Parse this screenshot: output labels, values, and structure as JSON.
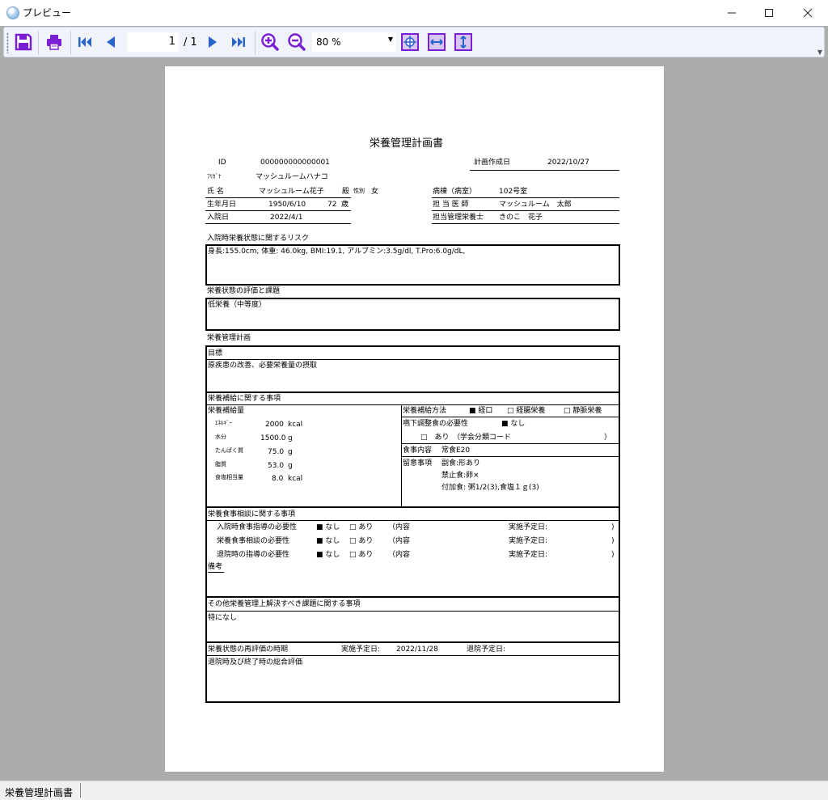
{
  "window": {
    "title": "プレビュー",
    "minimize": "—",
    "maximize": "☐",
    "close": "✕"
  },
  "toolbar": {
    "page_current": "1",
    "page_total": "/ 1",
    "zoom": "80 %"
  },
  "doc": {
    "title": "栄養管理計画書",
    "id_label": "ID",
    "id_value": "000000000000001",
    "plan_date_label": "計画作成日",
    "plan_date_value": "2022/10/27",
    "furigana_label": "ﾌﾘｶﾞﾅ",
    "furigana_value": "マッシュルームハナコ",
    "name_label": "氏 名",
    "name_value": "マッシュルーム花子",
    "name_suffix": "殿",
    "sex_label": "性別",
    "sex_value": "女",
    "ward_label": "病棟（病室）",
    "ward_value": "102号室",
    "birth_label": "生年月日",
    "birth_value": "1950/6/10",
    "age_value": "72",
    "age_unit": "歳",
    "doctor_label": "担 当 医 師",
    "doctor_value": "マッシュルーム　太郎",
    "admission_label": "入院日",
    "admission_value": "2022/4/1",
    "dietitian_label": "担当管理栄養士",
    "dietitian_value": "きのこ　花子",
    "risk_heading": "入院時栄養状態に関するリスク",
    "risk_text": "身長:155.0cm, 体重: 46.0kg, BMI:19.1, アルブミン:3.5g/dl,  T.Pro:6.0g/dL,",
    "eval_heading": "栄養状態の評価と課題",
    "eval_text": "低栄養（中等度）",
    "plan_heading": "栄養管理計画",
    "goal_label": "目標",
    "goal_text": "原疾患の改善、必要栄養量の摂取",
    "supply_heading": "栄養補給に関する事項",
    "supply_amount_label": "栄養補給量",
    "energy_label": "ｴﾈﾙｷﾞｰ",
    "energy_value": "2000",
    "energy_unit": "kcal",
    "water_label": "水分",
    "water_value": "1500.0",
    "water_unit": "g",
    "protein_label": "たんぱく質",
    "protein_value": "75.0",
    "protein_unit": "g",
    "fat_label": "脂質",
    "fat_value": "53.0",
    "fat_unit": "g",
    "salt_label": "食塩相当量",
    "salt_value": "8.0",
    "salt_unit": "kcal",
    "method_label": "栄養補給方法",
    "method_oral": "■ 経口",
    "method_tube": "□ 経腸栄養",
    "method_iv": "□ 静脈栄養",
    "swallow_label": "嚥下調整食の必要性",
    "swallow_none": "■ なし",
    "swallow_yes": "□　あり　（学会分類コード",
    "swallow_close": "）",
    "meal_label": "食事内容",
    "meal_value": "常食E20",
    "note_label": "留意事項",
    "note_line1": "副食:形あり",
    "note_line2": "禁止食:卵×",
    "note_line3": "付加食: 粥1/2(3),食塩１ｇ(3)",
    "consult_heading": "栄養食事相談に関する事項",
    "consult_rows": [
      {
        "label": "入院時食事指導の必要性",
        "none": "■ なし",
        "yes": "□ あり",
        "content": "（内容",
        "date": "実施予定日:",
        "close": ")"
      },
      {
        "label": "栄養食事相談の必要性",
        "none": "■ なし",
        "yes": "□ あり",
        "content": "（内容",
        "date": "実施予定日:",
        "close": ")"
      },
      {
        "label": "退院時の指導の必要性",
        "none": "■ なし",
        "yes": "□ あり",
        "content": "（内容",
        "date": "実施予定日:",
        "close": ")"
      }
    ],
    "remarks_label": "備考",
    "other_heading": "その他栄養管理上解決すべき課題に関する事項",
    "other_text": "特になし",
    "reeval_label": "栄養状態の再評価の時期",
    "reeval_date_label": "実施予定日:",
    "reeval_date_value": "2022/11/28",
    "discharge_date_label": "退院予定日:",
    "final_label": "退院時及び終了時の総合評価"
  },
  "status": {
    "text": "栄養管理計画書"
  },
  "colors": {
    "accent": "#7b1fd4",
    "nav": "#2a63c9"
  }
}
